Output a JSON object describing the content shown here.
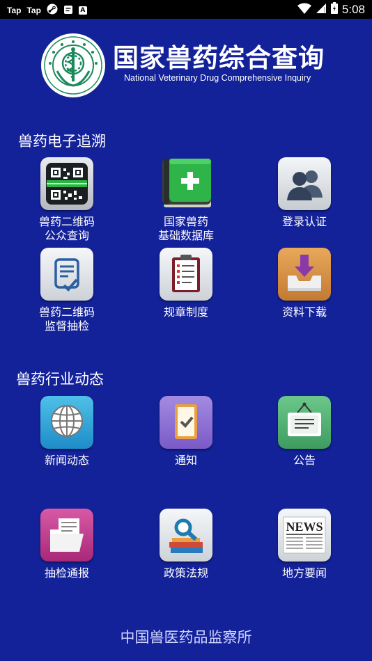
{
  "status_bar": {
    "app1": "Tap",
    "app2": "Tap",
    "box_letter": "A",
    "time": "5:08"
  },
  "header": {
    "title": "国家兽药综合查询",
    "subtitle": "National Veterinary Drug Comprehensive Inquiry",
    "logo_text": "中国兽医药品监察所 China Institute of Veterinary Drug Control"
  },
  "sections": [
    {
      "title": "兽药电子追溯",
      "items": [
        {
          "label": "兽药二维码\n公众查询",
          "icon": "qr-code-scan-icon"
        },
        {
          "label": "国家兽药\n基础数据库",
          "icon": "database-book-icon"
        },
        {
          "label": "登录认证",
          "icon": "users-login-icon"
        },
        {
          "label": "兽药二维码\n监督抽检",
          "icon": "document-check-icon"
        },
        {
          "label": "规章制度",
          "icon": "clipboard-list-icon"
        },
        {
          "label": "资料下载",
          "icon": "download-icon"
        }
      ]
    },
    {
      "title": "兽药行业动态",
      "items": [
        {
          "label": "新闻动态",
          "icon": "globe-icon"
        },
        {
          "label": "通知",
          "icon": "notice-check-icon"
        },
        {
          "label": "公告",
          "icon": "announcement-board-icon"
        },
        {
          "label": "抽检通报",
          "icon": "folder-report-icon"
        },
        {
          "label": "政策法规",
          "icon": "policy-search-icon"
        },
        {
          "label": "地方要闻",
          "icon": "newspaper-icon"
        }
      ]
    }
  ],
  "icon_texts": {
    "news": "NEWS"
  },
  "footer": "中国兽医药品监察所",
  "colors": {
    "background": "#14229a",
    "status_bar": "#000000",
    "green_accent": "#2fb44a",
    "purple_accent": "#8a6ad0",
    "pink_accent": "#c0388a",
    "orange_accent": "#d99040"
  }
}
